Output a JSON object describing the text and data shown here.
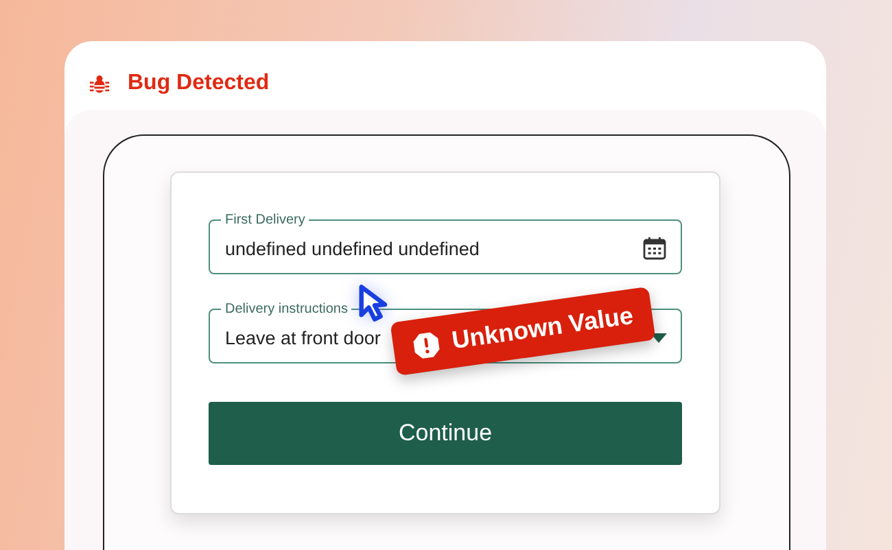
{
  "header": {
    "title": "Bug Detected"
  },
  "form": {
    "fields": [
      {
        "kind": "date",
        "label": "First Delivery",
        "value": "undefined undefined undefined"
      },
      {
        "kind": "select",
        "label": "Delivery instructions",
        "value": "Leave at front door"
      }
    ],
    "button": "Continue"
  },
  "error_badge": {
    "text": "Unknown Value"
  }
}
